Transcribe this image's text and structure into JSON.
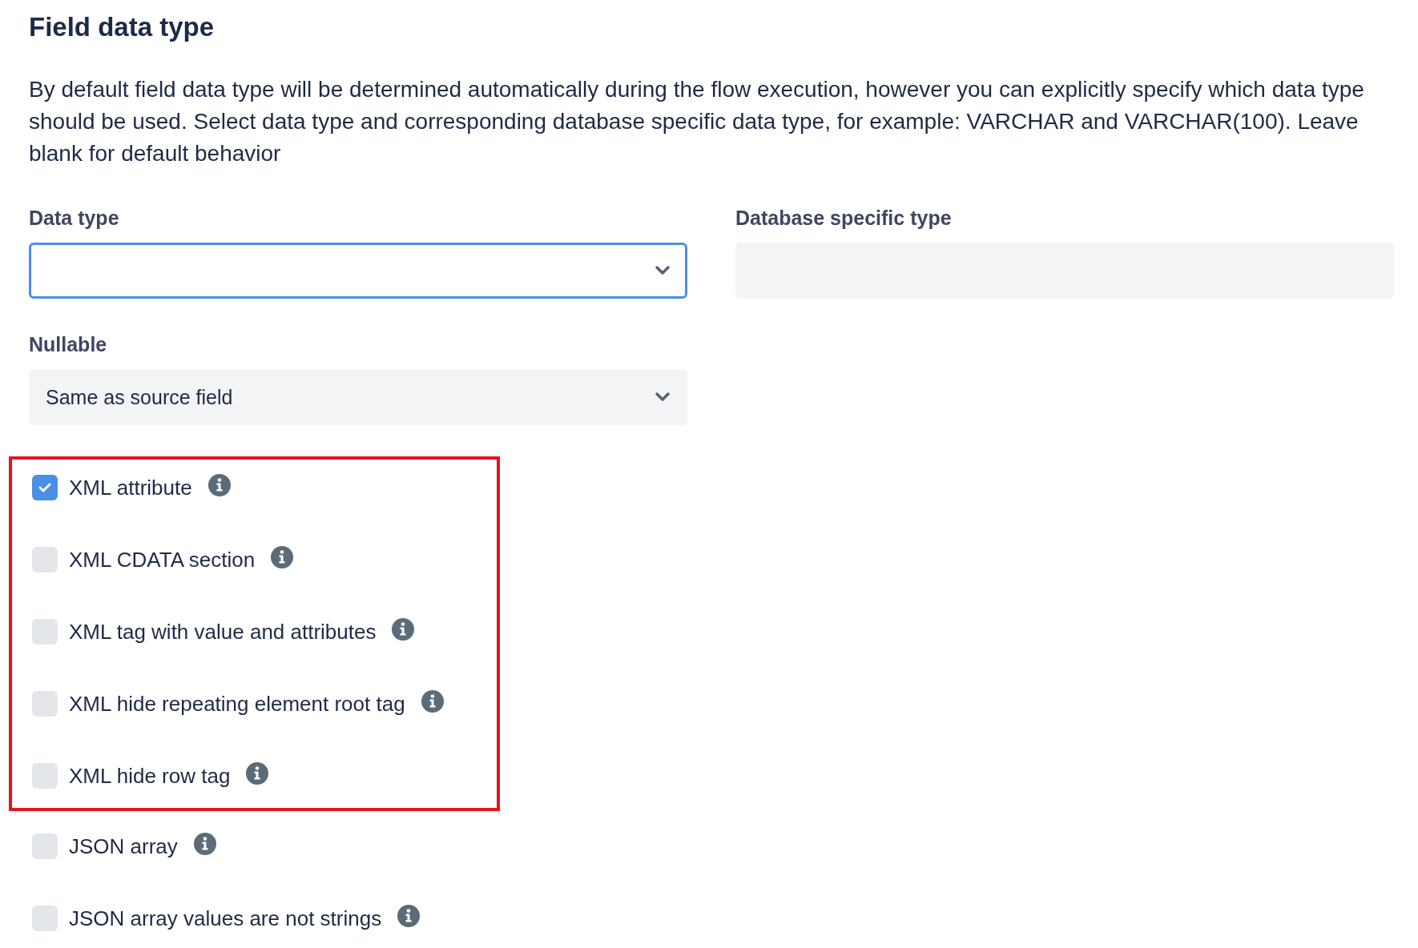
{
  "title": "Field data type",
  "description": "By default field data type will be determined automatically during the flow execution, however you can explicitly specify which data type should be used. Select data type and corresponding database specific data type, for example: VARCHAR and VARCHAR(100). Leave blank for default behavior",
  "data_type": {
    "label": "Data type",
    "focused": true
  },
  "database_specific_type": {
    "label": "Database specific type"
  },
  "nullable": {
    "label": "Nullable",
    "value": "Same as source field",
    "focused": false
  },
  "highlight_frame": {
    "options": [
      {
        "label": "XML attribute",
        "checked": true
      },
      {
        "label": "XML CDATA section",
        "checked": false
      },
      {
        "label": "XML tag with value and attributes",
        "checked": false
      },
      {
        "label": "XML hide repeating element root tag",
        "checked": false
      },
      {
        "label": "XML hide row tag",
        "checked": false
      }
    ]
  },
  "options": [
    {
      "label": "JSON array",
      "checked": false
    },
    {
      "label": "JSON array values are not strings",
      "checked": false
    }
  ]
}
